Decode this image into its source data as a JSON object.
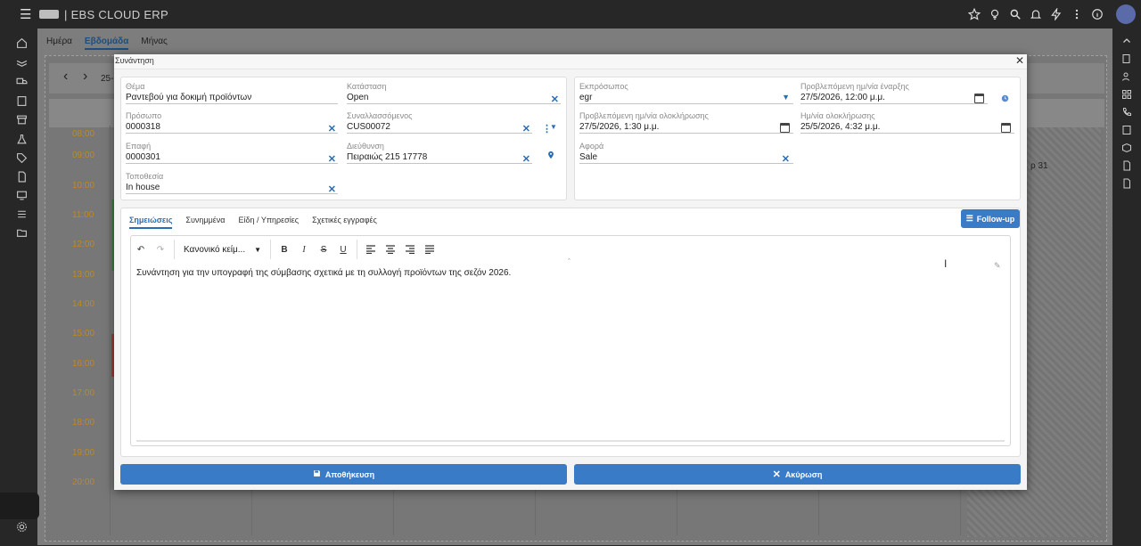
{
  "app": {
    "title": "| EBS CLOUD ERP"
  },
  "calendar": {
    "view_tabs": [
      "Ημέρα",
      "Εβδομάδα",
      "Μήνας"
    ],
    "date_range_partial": "25-",
    "day_label": "ρ 31",
    "times": [
      "08:00",
      "09:00",
      "10:00",
      "11:00",
      "12:00",
      "13:00",
      "14:00",
      "15:00",
      "16:00",
      "17:00",
      "18:00",
      "19:00",
      "20:00"
    ]
  },
  "modal": {
    "title": "Συνάντηση",
    "fields": {
      "subject": {
        "label": "Θέμα",
        "value": "Ραντεβού για δοκιμή προϊόντων"
      },
      "status": {
        "label": "Κατάσταση",
        "value": "Open"
      },
      "person": {
        "label": "Πρόσωπο",
        "value": "0000318"
      },
      "trader": {
        "label": "Συναλλασσόμενος",
        "value": "CUS00072"
      },
      "contact": {
        "label": "Επαφή",
        "value": "0000301"
      },
      "address": {
        "label": "Διεύθυνση",
        "value": "Πειραιώς 215 17778"
      },
      "location": {
        "label": "Τοποθεσία",
        "value": "In house"
      },
      "representative": {
        "label": "Εκπρόσωπος",
        "value": "egr"
      },
      "planned_start": {
        "label": "Προβλεπόμενη ημ/νία έναρξης",
        "value": "27/5/2026, 12:00 μ.μ."
      },
      "planned_end": {
        "label": "Προβλεπόμενη ημ/νία ολοκλήρωσης",
        "value": "27/5/2026, 1:30 μ.μ."
      },
      "completion_date": {
        "label": "Ημ/νία ολοκλήρωσης",
        "value": "25/5/2026, 4:32 μ.μ."
      },
      "regarding": {
        "label": "Αφορά",
        "value": "Sale"
      }
    },
    "tabs": [
      "Σημειώσεις",
      "Συνημμένα",
      "Είδη / Υπηρεσίες",
      "Σχετικές εγγραφές"
    ],
    "followup_label": "Follow-up",
    "editor": {
      "style_dropdown": "Κανονικό κείμ...",
      "text": "Συνάντηση για την υπογραφή της σύμβασης σχετικά με τη συλλογή προϊόντων της σεζόν 2026."
    },
    "save_label": "Αποθήκευση",
    "cancel_label": "Ακύρωση"
  },
  "colors": {
    "accent": "#3a7bc8",
    "topbar": "#272727",
    "time": "#c08a1a"
  }
}
